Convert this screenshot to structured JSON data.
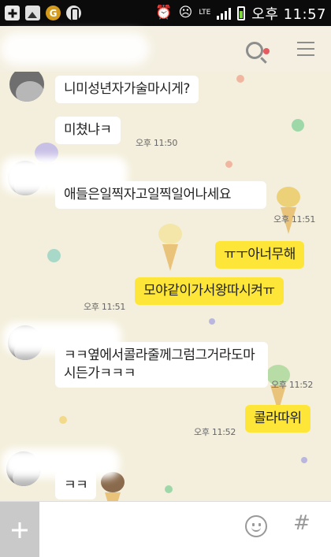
{
  "status_bar": {
    "network": "LTE",
    "time": "오후 11:57",
    "icons": [
      "plus-icon",
      "image-icon",
      "g-icon",
      "paren-icon",
      "alarm-icon",
      "face-icon",
      "signal-icon",
      "battery-icon"
    ]
  },
  "header": {
    "chat_title": "",
    "icons": [
      "search-icon",
      "menu-icon"
    ]
  },
  "messages": [
    {
      "side": "in",
      "text": "니미성년자가술마시게?",
      "time": ""
    },
    {
      "side": "in",
      "text": "미쳤냐ㅋ",
      "time": "오후 11:50"
    },
    {
      "side": "in",
      "text": "애들은일찍자고일찍일어나세요",
      "time": "오후 11:51"
    },
    {
      "side": "out",
      "text": "ㅠㅜ아너무해",
      "time": ""
    },
    {
      "side": "out",
      "text": "모야같이가서왕따시켜ㅠ",
      "time": "오후 11:51"
    },
    {
      "side": "in",
      "text": "ㅋㅋ옆에서콜라줄께그럼그거라도마시든가ㅋㅋㅋ",
      "time": "오후 11:52"
    },
    {
      "side": "out",
      "text": "콜라따위",
      "time": "오후 11:52"
    },
    {
      "side": "in",
      "text": "ㅋㅋ",
      "time": ""
    }
  ],
  "input_bar": {
    "hash_label": "#",
    "icons": [
      "plus-icon",
      "emoji-icon",
      "hash-icon"
    ]
  },
  "colors": {
    "chat_bg": "#f4efdc",
    "incoming_bubble": "#ffffff",
    "outgoing_bubble": "#fde638"
  }
}
